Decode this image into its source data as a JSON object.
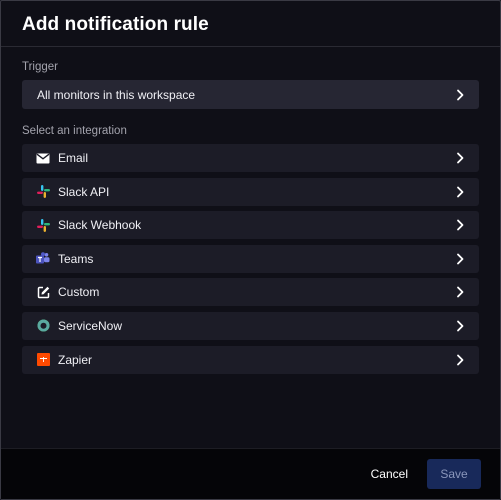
{
  "dialog": {
    "title": "Add notification rule",
    "trigger_label": "Trigger",
    "trigger_value": "All monitors in this workspace",
    "integration_label": "Select an integration"
  },
  "integrations": [
    {
      "label": "Email",
      "icon": "envelope-icon"
    },
    {
      "label": "Slack API",
      "icon": "slack-icon"
    },
    {
      "label": "Slack Webhook",
      "icon": "slack-icon"
    },
    {
      "label": "Teams",
      "icon": "teams-icon"
    },
    {
      "label": "Custom",
      "icon": "edit-icon"
    },
    {
      "label": "ServiceNow",
      "icon": "servicenow-icon"
    },
    {
      "label": "Zapier",
      "icon": "zapier-icon"
    }
  ],
  "footer": {
    "cancel_label": "Cancel",
    "save_label": "Save"
  },
  "colors": {
    "background": "#0f0f17",
    "item_background": "#1c1c27",
    "trigger_background": "#262633",
    "save_button": "#18295a"
  }
}
